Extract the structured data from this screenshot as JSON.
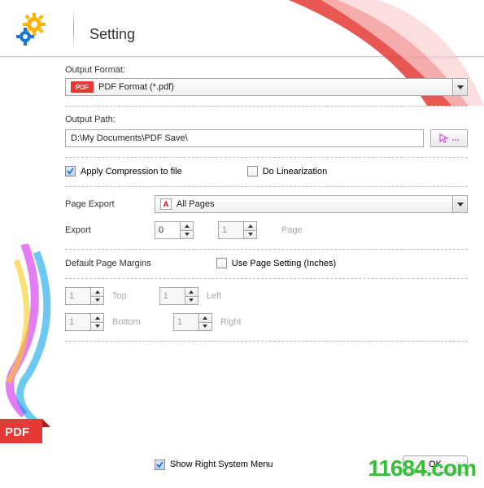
{
  "title": "Setting",
  "output_format": {
    "label": "Output Format:",
    "badge": "PDF",
    "value": "PDF Format (*.pdf)"
  },
  "output_path": {
    "label": "Output Path:",
    "value": "D:\\My Documents\\PDF Save\\",
    "browse": "..."
  },
  "compression": {
    "apply": {
      "label": "Apply Compression to file",
      "checked": true
    },
    "linearization": {
      "label": "Do Linearization",
      "checked": false
    }
  },
  "page_export": {
    "label": "Page Export",
    "value": "All Pages",
    "export_label": "Export",
    "from": "0",
    "to": "1",
    "page_label": "Page"
  },
  "margins": {
    "label": "Default Page Margins",
    "use_page_setting": {
      "label": "Use Page Setting (Inches)",
      "checked": false
    },
    "top": {
      "value": "1",
      "label": "Top"
    },
    "left": {
      "value": "1",
      "label": "Left"
    },
    "bottom": {
      "value": "1",
      "label": "Bottom"
    },
    "right": {
      "value": "1",
      "label": "Right"
    }
  },
  "footer": {
    "show_menu": {
      "label": "Show Right System Menu",
      "checked": true
    },
    "ok": "OK"
  },
  "watermark": "11684.com"
}
